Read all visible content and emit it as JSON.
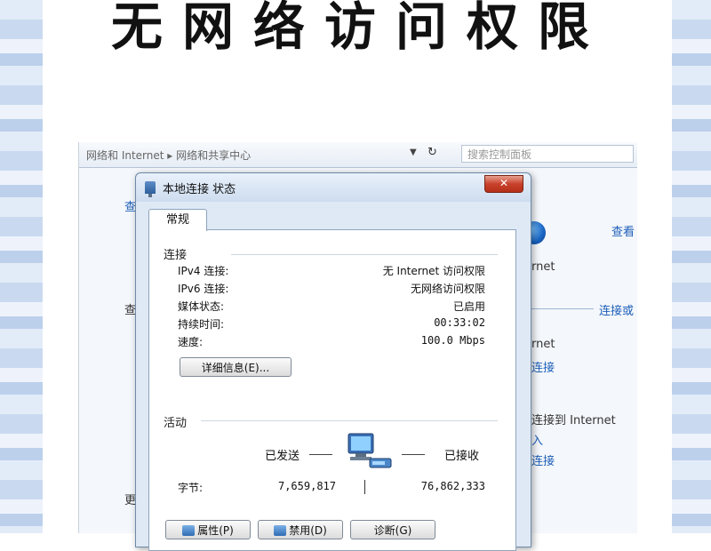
{
  "headline": "无网络访问权限",
  "explorer": {
    "breadcrumb": "网络和 Internet ▸ 网络和共享中心",
    "search_placeholder": "搜索控制面板",
    "refresh_icon": "↻",
    "left_text_1": "查",
    "left_text_2": "查",
    "left_text_3": "更",
    "link_view": "查看",
    "text_internet_1": "rnet",
    "link_connect_or": "连接或",
    "text_internet_2": "rnet",
    "link_connect": "连接",
    "text_connect_internet": "连接到 Internet",
    "link_input": "入",
    "link_connect_2": "连接"
  },
  "dialog": {
    "title": "本地连接 状态",
    "close_label": "✕",
    "tab_general": "常规",
    "connection": {
      "heading": "连接",
      "rows": [
        {
          "label": "IPv4 连接:",
          "value": "无 Internet 访问权限"
        },
        {
          "label": "IPv6 连接:",
          "value": "无网络访问权限"
        },
        {
          "label": "媒体状态:",
          "value": "已启用"
        },
        {
          "label": "持续时间:",
          "value": "00:33:02"
        },
        {
          "label": "速度:",
          "value": "100.0 Mbps"
        }
      ],
      "details_button": "详细信息(E)..."
    },
    "activity": {
      "heading": "活动",
      "sent_label": "已发送",
      "received_label": "已接收",
      "bytes_label": "字节:",
      "bytes_sent": "7,659,817",
      "bytes_received": "76,862,333"
    },
    "buttons": {
      "properties": "属性(P)",
      "disable": "禁用(D)",
      "diagnose": "诊断(G)"
    }
  }
}
